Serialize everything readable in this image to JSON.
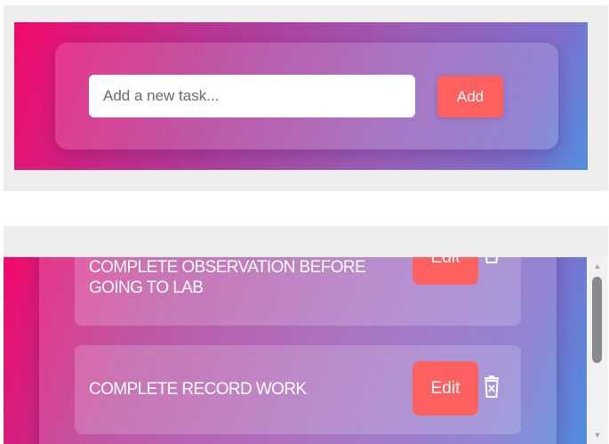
{
  "add_form": {
    "input_placeholder": "Add a new task...",
    "input_value": "",
    "add_label": "Add"
  },
  "tasks": [
    {
      "text": "COMPLETE OBSERVATION BEFORE GOING TO LAB",
      "edit_label": "Edit"
    },
    {
      "text": "COMPLETE RECORD WORK",
      "edit_label": "Edit"
    }
  ],
  "icons": {
    "delete": "trash-icon",
    "scroll_up": "scroll-up-arrow-icon",
    "scroll_down": "scroll-down-arrow-icon"
  },
  "colors": {
    "gradient_start": "#f20a6b",
    "gradient_mid": "#9a5fb8",
    "gradient_end": "#4f8ee0",
    "button": "#ff6060",
    "text": "#ffffff"
  }
}
